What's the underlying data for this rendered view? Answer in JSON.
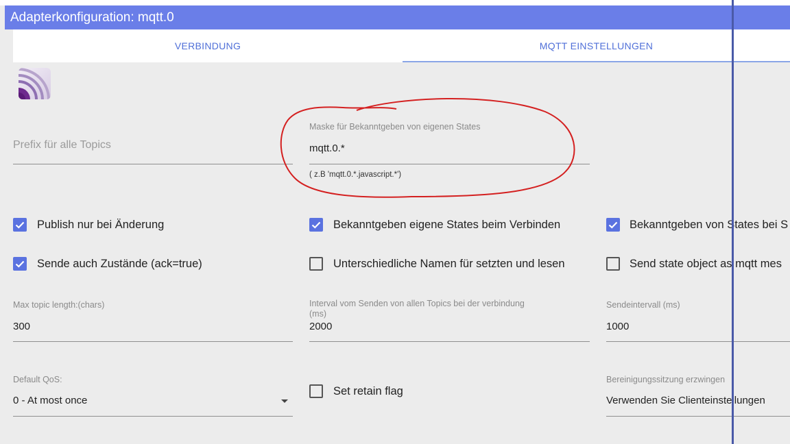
{
  "window": {
    "title": "Adapterkonfiguration: mqtt.0"
  },
  "tabs": [
    {
      "label": "VERBINDUNG",
      "active": false
    },
    {
      "label": "MQTT EINSTELLUNGEN",
      "active": true
    }
  ],
  "logo": {
    "icon": "mqtt-logo-icon"
  },
  "fields": {
    "prefix": {
      "placeholder": "Prefix für alle Topics",
      "value": ""
    },
    "mask": {
      "label": "Maske für Bekanntgeben von eigenen States",
      "value": "mqtt.0.*",
      "helper": "( z.B 'mqtt.0.*.javascript.*')"
    },
    "max_topic_length": {
      "label": "Max topic length:(chars)",
      "value": "300"
    },
    "interval": {
      "label_line1": "Interval vom Senden von allen Topics bei der verbindung",
      "label_line2": "(ms)",
      "value": "2000"
    },
    "send_interval": {
      "label": "Sendeintervall (ms)",
      "value": "1000"
    },
    "default_qos": {
      "label": "Default QoS:",
      "value": "0 - At most once"
    },
    "clean_session": {
      "label": "Bereinigungssitzung erzwingen",
      "value": "Verwenden Sie Clienteinstellungen"
    }
  },
  "checkboxes": {
    "publish_on_change": {
      "label": "Publish nur bei Änderung",
      "checked": true
    },
    "publish_own_states": {
      "label": "Bekanntgeben eigene States beim Verbinden",
      "checked": true
    },
    "publish_states_s": {
      "label": "Bekanntgeben von States bei S",
      "checked": true
    },
    "send_ack": {
      "label": "Sende auch Zustände (ack=true)",
      "checked": true
    },
    "different_names": {
      "label": "Unterschiedliche Namen für setzten und lesen",
      "checked": false
    },
    "send_state_object": {
      "label": "Send state object as mqtt mes",
      "checked": false
    },
    "retain_flag": {
      "label": "Set retain flag",
      "checked": false
    }
  },
  "colors": {
    "titlebar": "#6a7ee8",
    "accent": "#5a72e0",
    "annotation": "#d42020",
    "vertical_line": "#4a5aa8"
  }
}
